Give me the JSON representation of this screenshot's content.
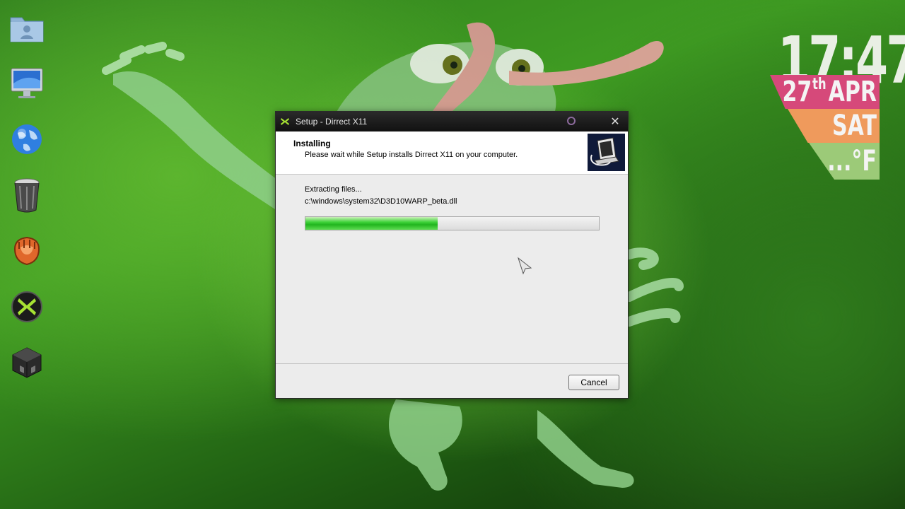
{
  "window": {
    "title": "Setup - Dirrect X11",
    "header_title": "Installing",
    "header_subtitle": "Please wait while Setup installs Dirrect X11 on your computer.",
    "status_line": "Extracting files...",
    "current_file": "c:\\windows\\system32\\D3D10WARP_beta.dll",
    "progress": 0.45,
    "cancel_label": "Cancel"
  },
  "clock": {
    "time": "17:47",
    "day_number": "27",
    "day_suffix": "th",
    "month": "APR",
    "weekday": "SAT",
    "temperature": "...°F"
  },
  "desktop_icons": [
    "folder-icon",
    "monitor-icon",
    "globe-icon",
    "trash-icon",
    "baseball-glove-icon",
    "directx-icon",
    "cube-icon"
  ],
  "colors": {
    "date_ribbon": "#d6497a",
    "day_ribbon": "#ef9a5c",
    "temp_ribbon": "#9cca78",
    "progress_green": "#22b51f"
  }
}
